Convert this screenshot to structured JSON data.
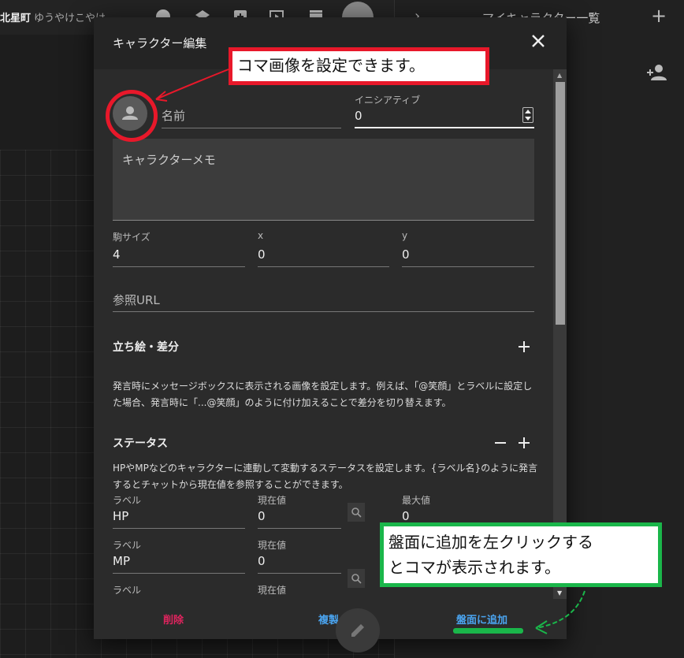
{
  "topbar": {
    "room_name": "北星町",
    "room_sub": "ゆうやけこやけ"
  },
  "right_panel": {
    "title": "マイキャラクター一覧"
  },
  "dialog": {
    "title": "キャラクター編集",
    "name_placeholder": "名前",
    "initiative_label": "イニシアティブ",
    "initiative_value": "0",
    "memo_placeholder": "キャラクターメモ",
    "size_label": "駒サイズ",
    "size_value": "4",
    "x_label": "x",
    "x_value": "0",
    "y_label": "y",
    "y_value": "0",
    "url_placeholder": "参照URL",
    "portrait": {
      "title": "立ち絵・差分",
      "desc": "発言時にメッセージボックスに表示される画像を設定します。例えば、「@笑顔」とラベルに設定した場合、発言時に「...@笑顔」のように付け加えることで差分を切り替えます。"
    },
    "status": {
      "title": "ステータス",
      "desc": "HPやMPなどのキャラクターに連動して変動するステータスを設定します。{ラベル名}のように発言するとチャットから現在値を参照することができます。",
      "label_header": "ラベル",
      "current_header": "現在値",
      "max_header": "最大値",
      "rows": [
        {
          "label": "HP",
          "current": "0",
          "max": "0"
        },
        {
          "label": "MP",
          "current": "0",
          "max": ""
        },
        {
          "label": "",
          "current": "",
          "max": ""
        }
      ]
    },
    "footer": {
      "delete": "削除",
      "duplicate": "複製",
      "add_to_board": "盤面に追加"
    }
  },
  "annotations": {
    "red_callout": "コマ画像を設定できます。",
    "green_callout_line1": "盤面に追加を左クリックする",
    "green_callout_line2": "とコマが表示されます。"
  },
  "colors": {
    "delete": "#e0245e",
    "action": "#4aa3ee",
    "annotation_red": "#e8182a",
    "annotation_green": "#1ab64a"
  },
  "icons": [
    "person-icon",
    "close-icon",
    "plus-icon",
    "minus-icon",
    "magnify-icon",
    "pencil-icon",
    "add-user-icon",
    "chevron-icon"
  ]
}
